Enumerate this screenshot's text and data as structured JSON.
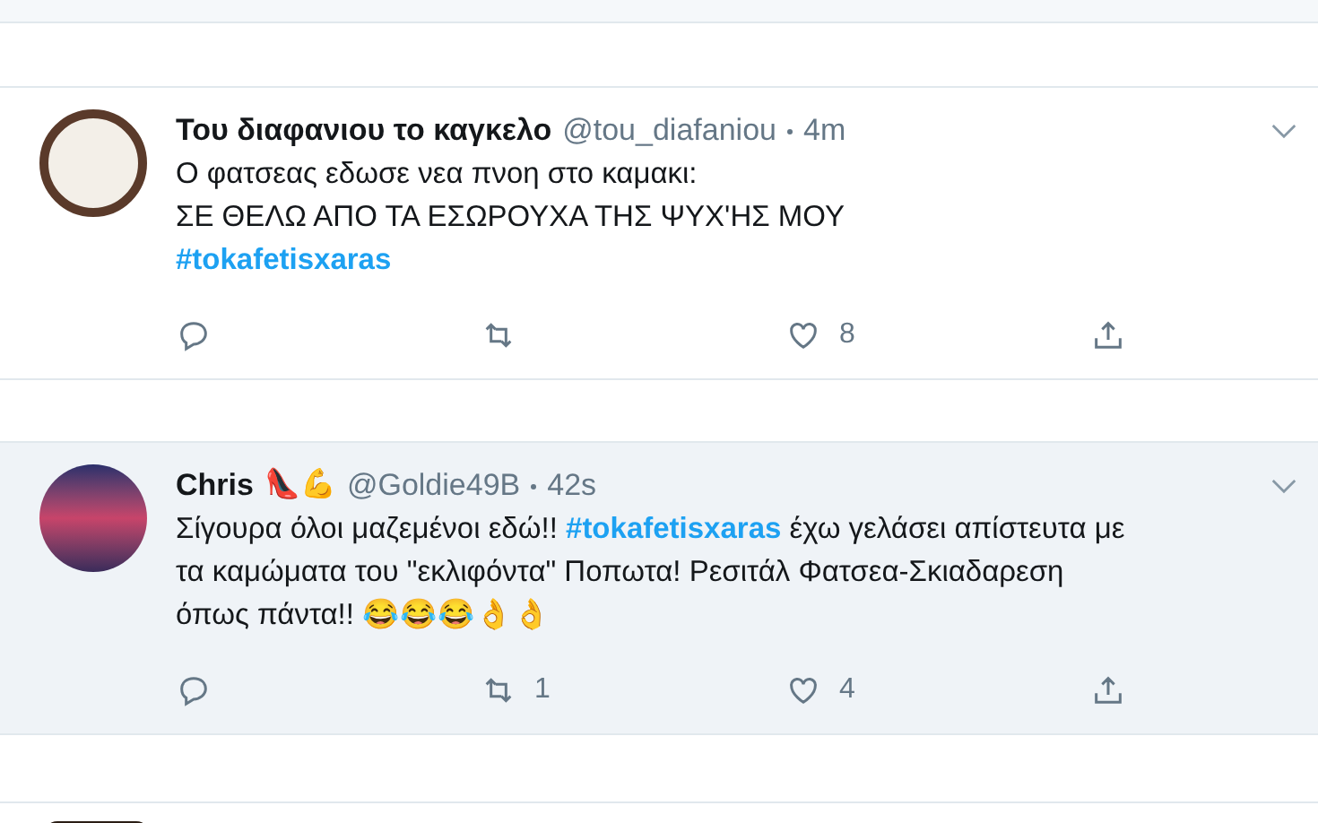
{
  "tweets": [
    {
      "name": "Του διαφανιου το καγκελο",
      "handle": "@tou_diafaniou",
      "time": "4m",
      "avatar": {
        "kind": "logo"
      },
      "highlighted": false,
      "body": [
        {
          "kind": "text",
          "text": "Ο φατσεας εδωσε νεα πνοη στο καμακι:"
        },
        {
          "kind": "break"
        },
        {
          "kind": "text",
          "text": "ΣΕ ΘΕΛΩ ΑΠΟ ΤΑ ΕΣΩΡΟΥΧΑ ΤΗΣ ΨΥΧ'ΗΣ ΜΟΥ"
        },
        {
          "kind": "break"
        },
        {
          "kind": "hashtag",
          "text": "#tokafetisxaras"
        }
      ],
      "likes": "8"
    },
    {
      "name": "Chris",
      "name_emoji": "👠💪",
      "handle": "@Goldie49B",
      "time": "42s",
      "avatar": {
        "kind": "photo"
      },
      "highlighted": true,
      "body": [
        {
          "kind": "text",
          "text": "Σίγουρα όλοι μαζεμένοι εδώ!! "
        },
        {
          "kind": "hashtag",
          "text": "#tokafetisxaras"
        },
        {
          "kind": "text",
          "text": " έχω γελάσει απίστευτα με"
        },
        {
          "kind": "break"
        },
        {
          "kind": "text",
          "text": "τα καμώματα του \"εκλιφόντα\" Ποπωτα! Ρεσιτάλ Φατσεα-Σκιαδαρεση"
        },
        {
          "kind": "break"
        },
        {
          "kind": "text",
          "text": "όπως πάντα!! 😂😂😂👌👌"
        }
      ],
      "retweets": "1",
      "likes": "4"
    }
  ]
}
